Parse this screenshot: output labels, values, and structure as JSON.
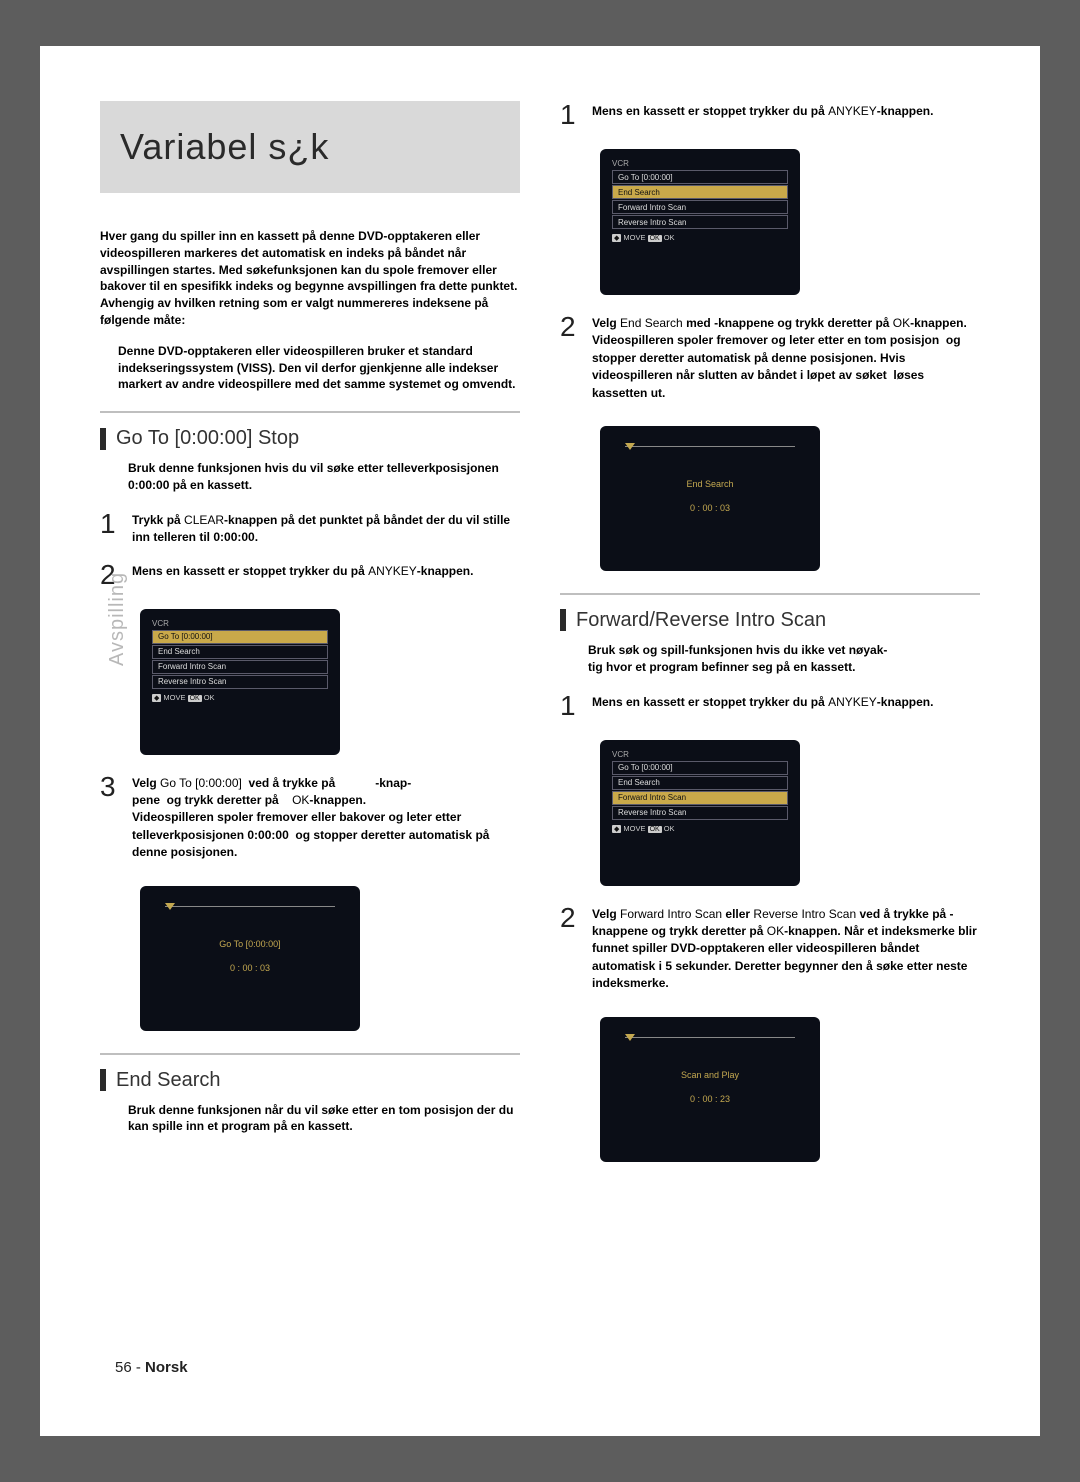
{
  "title": "Variabel s¿k",
  "intro": "Hver gang du spiller inn en kassett på denne DVD-opptakeren eller videospilleren  markeres det automatisk en       indeks  på båndet når avspillingen startes. Med søkefunksjonen kan du spole fremover eller bakover til en spesifikk indeks og begynne avspillingen fra dette punktet. Avhengig av hvilken retning som er valgt  nummereres indeksene på følgende måte:",
  "note": "Denne DVD-opptakeren eller videospilleren bruker et standard indekseringssystem (VISS). Den vil derfor gjenkjenne alle indekser markert av andre videospillere med det samme systemet  og omvendt.",
  "sideTab": "Avspilling",
  "footer": {
    "page": "56 -",
    "lang": "Norsk"
  },
  "sections": {
    "goto": {
      "title": "Go To [0:00:00] Stop",
      "desc": "Bruk denne funksjonen hvis du vil søke etter telleverkposisjonen 0:00:00 på en kassett.",
      "step1_a": "Trykk på ",
      "step1_b": "CLEAR",
      "step1_c": "-knappen på det punktet på båndet der du vil stille inn telleren til 0:00:00.",
      "step2_a": "Mens en kassett er stoppet  trykker du på ",
      "step2_b": "ANYKEY",
      "step2_c": "-knappen.",
      "step3_a": "Velg ",
      "step3_b": "Go To [0:00:00]",
      "step3_c": "  ved å trykke på            -knap-\npene  og trykk deretter på    ",
      "step3_d": "OK",
      "step3_e": "-knappen.\nVideospilleren spoler fremover eller bakover og leter etter telleverkposisjonen 0:00:00  og stopper deretter automatisk på denne posisjonen."
    },
    "end": {
      "title": "End Search",
      "desc": "Bruk denne funksjonen når du vil søke etter en tom posisjon der du kan spille inn et program på en kassett.",
      "r_step1_a": "Mens en kassett er stoppet  trykker du på ",
      "r_step1_b": "ANYKEY",
      "r_step1_c": "-knappen.",
      "r_step2_a": "Velg ",
      "r_step2_b": "End Search",
      "r_step2_c": "  med           -knappene  og trykk deretter på    ",
      "r_step2_d": "OK",
      "r_step2_e": "-knappen.\nVideospilleren spoler fremover og leter etter en tom posisjon  og stopper deretter automatisk på denne posisjonen. Hvis videospilleren når slutten av båndet i løpet av søket  løses kassetten ut."
    },
    "intro2": {
      "title": "Forward/Reverse Intro Scan",
      "desc": "Bruk søk og spill-funksjonen hvis du ikke vet nøyak-\ntig hvor et program befinner seg på en kassett.",
      "step1_a": "Mens en kassett er stoppet  trykker du på ",
      "step1_b": "ANYKEY",
      "step1_c": "-knappen.",
      "step2_a": "Velg ",
      "step2_b": "Forward Intro Scan",
      "step2_bo": "   eller ",
      "step2_bb": "Reverse Intro Scan",
      "step2_c": "  ved å trykke på           -knappene  og trykk deretter på    ",
      "step2_d": "OK",
      "step2_e": "-knappen. Når et indeksmerke blir funnet  spiller DVD-opptakeren eller videospilleren båndet automatisk i 5 sekunder. Deretter begynner den å søke etter neste indeksmerke."
    }
  },
  "osd": {
    "label": "VCR",
    "rows": [
      "Go To [0:00:00]",
      "End Search",
      "Forward Intro Scan",
      "Reverse Intro Scan"
    ],
    "move": "MOVE",
    "ok": "OK",
    "gotoPlay": {
      "t1": "Go To [0:00:00]",
      "t2": "0 : 00 : 03"
    },
    "endPlay": {
      "t1": "End Search",
      "t2": "0 : 00 : 03"
    },
    "scanPlay": {
      "t1": "Scan and Play",
      "t2": "0 : 00 : 23"
    }
  }
}
